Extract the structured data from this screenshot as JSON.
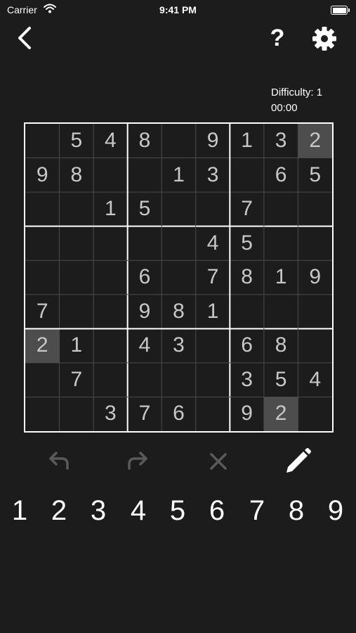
{
  "status_bar": {
    "carrier": "Carrier",
    "time": "9:41 PM"
  },
  "header": {
    "back_icon": "chevron-left-icon",
    "help_label": "?",
    "settings_icon": "gear-icon"
  },
  "info": {
    "difficulty": "Difficulty: 1",
    "timer": "00:00"
  },
  "board": {
    "rows": [
      [
        "",
        "5",
        "4",
        "8",
        "",
        "9",
        "1",
        "3",
        "2"
      ],
      [
        "9",
        "8",
        "",
        "",
        "1",
        "3",
        "",
        "6",
        "5"
      ],
      [
        "",
        "",
        "1",
        "5",
        "",
        "",
        "7",
        "",
        ""
      ],
      [
        "",
        "",
        "",
        "",
        "",
        "4",
        "5",
        "",
        ""
      ],
      [
        "",
        "",
        "",
        "6",
        "",
        "7",
        "8",
        "1",
        "9"
      ],
      [
        "7",
        "",
        "",
        "9",
        "8",
        "1",
        "",
        "",
        ""
      ],
      [
        "2",
        "1",
        "",
        "4",
        "3",
        "",
        "6",
        "8",
        ""
      ],
      [
        "",
        "7",
        "",
        "",
        "",
        "",
        "3",
        "5",
        "4"
      ],
      [
        "",
        "",
        "3",
        "7",
        "6",
        "",
        "9",
        "2",
        ""
      ]
    ],
    "highlighted_cells": [
      [
        0,
        8
      ],
      [
        6,
        0
      ],
      [
        8,
        7
      ]
    ]
  },
  "toolbar": {
    "undo_icon": "undo-icon",
    "redo_icon": "redo-icon",
    "erase_icon": "erase-icon",
    "pencil_icon": "pencil-icon"
  },
  "numpad": [
    "1",
    "2",
    "3",
    "4",
    "5",
    "6",
    "7",
    "8",
    "9"
  ],
  "colors": {
    "background": "#1c1c1c",
    "cell_highlight": "#4d4d4d",
    "given_digit": "#c8c8c8",
    "disabled_icon": "#5a5a5a"
  }
}
